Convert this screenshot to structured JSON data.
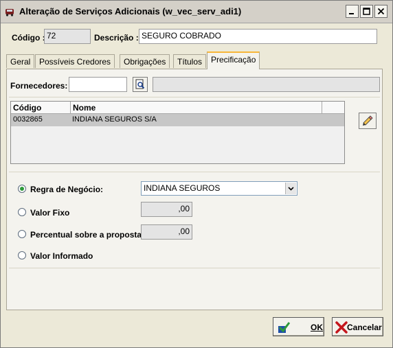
{
  "window": {
    "title": "Alteração de Serviços Adicionais (w_vec_serv_adi1)",
    "icon": "car-icon"
  },
  "header": {
    "codigo_label": "Código :",
    "codigo_value": "72",
    "descricao_label": "Descrição :",
    "descricao_value": "SEGURO COBRADO"
  },
  "tabs": [
    {
      "label": "Geral"
    },
    {
      "label": "Possíveis Credores"
    },
    {
      "label": "Obrigações"
    },
    {
      "label": "Títulos"
    },
    {
      "label": "Precificação",
      "active": true
    }
  ],
  "fornecedores": {
    "label": "Fornecedores:",
    "value": "",
    "description": ""
  },
  "grid": {
    "columns": [
      "Código",
      "Nome"
    ],
    "rows": [
      {
        "codigo": "0032865",
        "nome": "INDIANA SEGUROS S/A"
      }
    ]
  },
  "pricing": {
    "regra_label": "Regra de Negócio:",
    "regra_value": "INDIANA SEGUROS",
    "valor_fixo_label": "Valor Fixo",
    "valor_fixo_value": ",00",
    "percentual_label": "Percentual sobre a proposta",
    "percentual_value": ",00",
    "valor_informado_label": "Valor Informado",
    "selected": "regra"
  },
  "buttons": {
    "ok_label": "OK",
    "cancel_label": "Cancelar"
  },
  "colors": {
    "window_bg": "#ece9d8",
    "active_tab_accent": "#f7b538",
    "radio_selected": "#2e9a3a"
  }
}
